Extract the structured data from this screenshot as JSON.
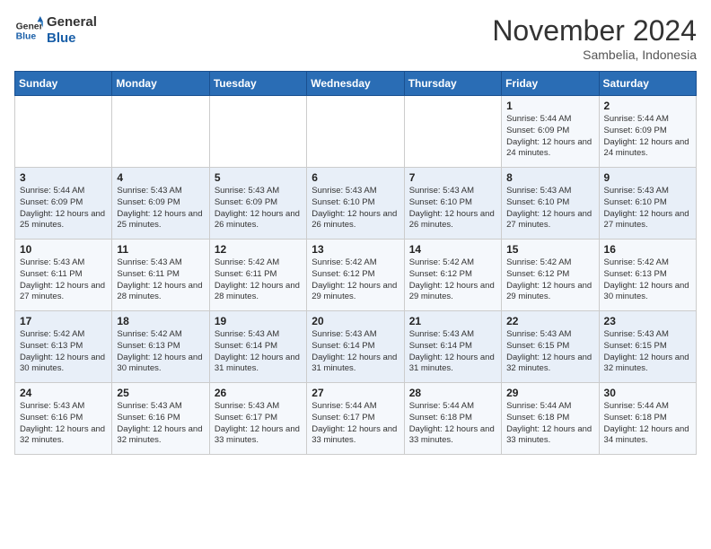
{
  "logo": {
    "line1": "General",
    "line2": "Blue"
  },
  "title": "November 2024",
  "location": "Sambelia, Indonesia",
  "days_header": [
    "Sunday",
    "Monday",
    "Tuesday",
    "Wednesday",
    "Thursday",
    "Friday",
    "Saturday"
  ],
  "weeks": [
    [
      {
        "day": "",
        "info": ""
      },
      {
        "day": "",
        "info": ""
      },
      {
        "day": "",
        "info": ""
      },
      {
        "day": "",
        "info": ""
      },
      {
        "day": "",
        "info": ""
      },
      {
        "day": "1",
        "info": "Sunrise: 5:44 AM\nSunset: 6:09 PM\nDaylight: 12 hours and 24 minutes."
      },
      {
        "day": "2",
        "info": "Sunrise: 5:44 AM\nSunset: 6:09 PM\nDaylight: 12 hours and 24 minutes."
      }
    ],
    [
      {
        "day": "3",
        "info": "Sunrise: 5:44 AM\nSunset: 6:09 PM\nDaylight: 12 hours and 25 minutes."
      },
      {
        "day": "4",
        "info": "Sunrise: 5:43 AM\nSunset: 6:09 PM\nDaylight: 12 hours and 25 minutes."
      },
      {
        "day": "5",
        "info": "Sunrise: 5:43 AM\nSunset: 6:09 PM\nDaylight: 12 hours and 26 minutes."
      },
      {
        "day": "6",
        "info": "Sunrise: 5:43 AM\nSunset: 6:10 PM\nDaylight: 12 hours and 26 minutes."
      },
      {
        "day": "7",
        "info": "Sunrise: 5:43 AM\nSunset: 6:10 PM\nDaylight: 12 hours and 26 minutes."
      },
      {
        "day": "8",
        "info": "Sunrise: 5:43 AM\nSunset: 6:10 PM\nDaylight: 12 hours and 27 minutes."
      },
      {
        "day": "9",
        "info": "Sunrise: 5:43 AM\nSunset: 6:10 PM\nDaylight: 12 hours and 27 minutes."
      }
    ],
    [
      {
        "day": "10",
        "info": "Sunrise: 5:43 AM\nSunset: 6:11 PM\nDaylight: 12 hours and 27 minutes."
      },
      {
        "day": "11",
        "info": "Sunrise: 5:43 AM\nSunset: 6:11 PM\nDaylight: 12 hours and 28 minutes."
      },
      {
        "day": "12",
        "info": "Sunrise: 5:42 AM\nSunset: 6:11 PM\nDaylight: 12 hours and 28 minutes."
      },
      {
        "day": "13",
        "info": "Sunrise: 5:42 AM\nSunset: 6:12 PM\nDaylight: 12 hours and 29 minutes."
      },
      {
        "day": "14",
        "info": "Sunrise: 5:42 AM\nSunset: 6:12 PM\nDaylight: 12 hours and 29 minutes."
      },
      {
        "day": "15",
        "info": "Sunrise: 5:42 AM\nSunset: 6:12 PM\nDaylight: 12 hours and 29 minutes."
      },
      {
        "day": "16",
        "info": "Sunrise: 5:42 AM\nSunset: 6:13 PM\nDaylight: 12 hours and 30 minutes."
      }
    ],
    [
      {
        "day": "17",
        "info": "Sunrise: 5:42 AM\nSunset: 6:13 PM\nDaylight: 12 hours and 30 minutes."
      },
      {
        "day": "18",
        "info": "Sunrise: 5:42 AM\nSunset: 6:13 PM\nDaylight: 12 hours and 30 minutes."
      },
      {
        "day": "19",
        "info": "Sunrise: 5:43 AM\nSunset: 6:14 PM\nDaylight: 12 hours and 31 minutes."
      },
      {
        "day": "20",
        "info": "Sunrise: 5:43 AM\nSunset: 6:14 PM\nDaylight: 12 hours and 31 minutes."
      },
      {
        "day": "21",
        "info": "Sunrise: 5:43 AM\nSunset: 6:14 PM\nDaylight: 12 hours and 31 minutes."
      },
      {
        "day": "22",
        "info": "Sunrise: 5:43 AM\nSunset: 6:15 PM\nDaylight: 12 hours and 32 minutes."
      },
      {
        "day": "23",
        "info": "Sunrise: 5:43 AM\nSunset: 6:15 PM\nDaylight: 12 hours and 32 minutes."
      }
    ],
    [
      {
        "day": "24",
        "info": "Sunrise: 5:43 AM\nSunset: 6:16 PM\nDaylight: 12 hours and 32 minutes."
      },
      {
        "day": "25",
        "info": "Sunrise: 5:43 AM\nSunset: 6:16 PM\nDaylight: 12 hours and 32 minutes."
      },
      {
        "day": "26",
        "info": "Sunrise: 5:43 AM\nSunset: 6:17 PM\nDaylight: 12 hours and 33 minutes."
      },
      {
        "day": "27",
        "info": "Sunrise: 5:44 AM\nSunset: 6:17 PM\nDaylight: 12 hours and 33 minutes."
      },
      {
        "day": "28",
        "info": "Sunrise: 5:44 AM\nSunset: 6:18 PM\nDaylight: 12 hours and 33 minutes."
      },
      {
        "day": "29",
        "info": "Sunrise: 5:44 AM\nSunset: 6:18 PM\nDaylight: 12 hours and 33 minutes."
      },
      {
        "day": "30",
        "info": "Sunrise: 5:44 AM\nSunset: 6:18 PM\nDaylight: 12 hours and 34 minutes."
      }
    ]
  ]
}
